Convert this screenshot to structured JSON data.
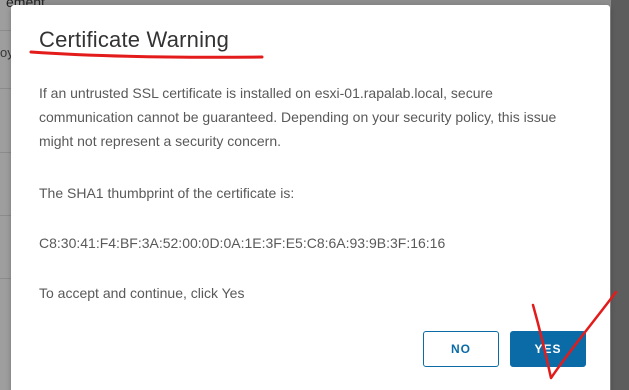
{
  "background": {
    "header_fragment": "ement",
    "side_fragment": "oy"
  },
  "dialog": {
    "title": "Certificate Warning",
    "paragraph_1": "If an untrusted SSL certificate is installed on esxi-01.rapalab.local, secure communication cannot be guaranteed. Depending on your security policy, this issue might not represent a security concern.",
    "paragraph_2": "The SHA1 thumbprint of the certificate is:",
    "thumbprint": "C8:30:41:F4:BF:3A:52:00:0D:0A:1E:3F:E5:C8:6A:93:9B:3F:16:16",
    "paragraph_3": "To accept and continue, click Yes",
    "no_label": "NO",
    "yes_label": "YES"
  },
  "colors": {
    "primary": "#0b6ba7",
    "annotation": "#e31b1b"
  }
}
